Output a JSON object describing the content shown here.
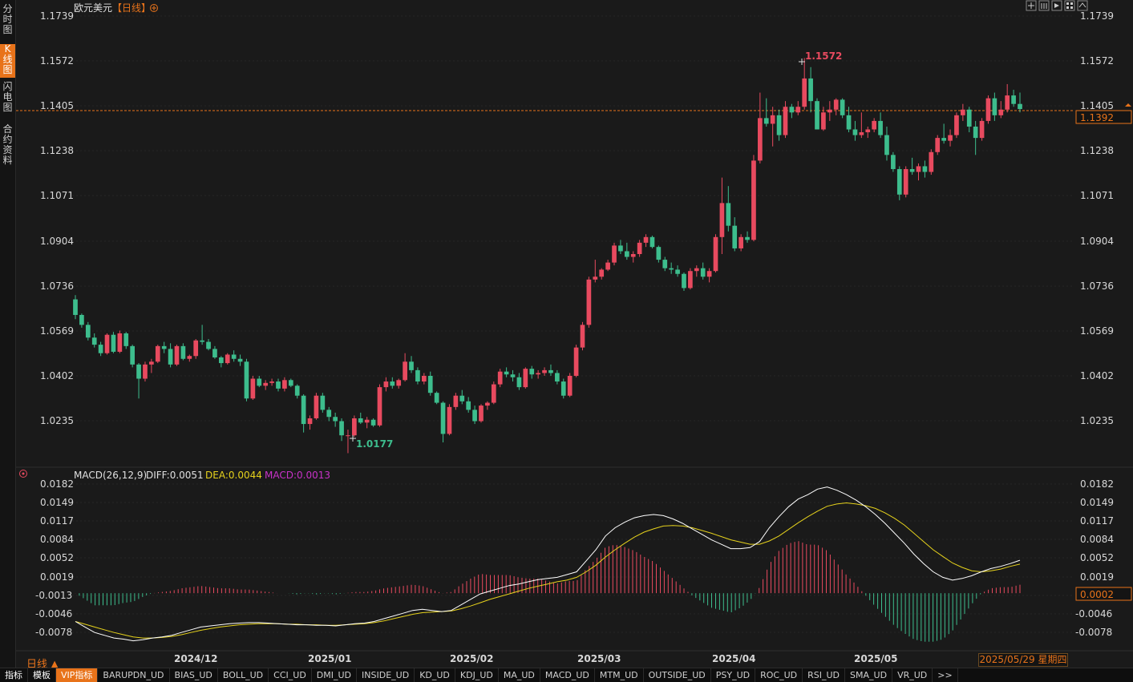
{
  "sidebar": {
    "tabs": [
      {
        "label": "分时图",
        "active": false
      },
      {
        "label": "K线图",
        "active": true
      },
      {
        "label": "闪电图",
        "active": false
      },
      {
        "label": "合约资料",
        "active": false
      }
    ]
  },
  "header": {
    "symbol": "欧元美元",
    "period_tag": "【日线】",
    "add_icon": "plus-circle-icon",
    "toolbar_icons": [
      "crosshair-icon",
      "table-icon",
      "play-icon",
      "grid-icon",
      "settings-icon"
    ]
  },
  "price_axis": {
    "labels": [
      "1.1739",
      "1.1572",
      "1.1405",
      "1.1238",
      "1.1071",
      "1.0904",
      "1.0736",
      "1.0569",
      "1.0402",
      "1.0235"
    ],
    "current_price": "1.1392"
  },
  "annotations": {
    "high": "1.1572",
    "low": "1.0177"
  },
  "macd": {
    "title": "MACD(26,12,9)",
    "diff": "DIFF:0.0051",
    "dea": "DEA:0.0044",
    "macd": "MACD:0.0013",
    "axis_labels": [
      "0.0182",
      "0.0149",
      "0.0117",
      "0.0084",
      "0.0052",
      "0.0019",
      "-0.0013",
      "-0.0046",
      "-0.0078"
    ],
    "current_value": "0.0002"
  },
  "time_axis": {
    "labels": [
      "2024/12",
      "2025/01",
      "2025/02",
      "2025/03",
      "2025/04",
      "2025/05"
    ]
  },
  "footer": {
    "period": "日线",
    "date": "2025/05/29 星期四",
    "tabs": [
      "指标",
      "模板",
      "VIP指标",
      "BARUPDN_UD",
      "BIAS_UD",
      "BOLL_UD",
      "CCI_UD",
      "DMI_UD",
      "INSIDE_UD",
      "KD_UD",
      "KDJ_UD",
      "MA_UD",
      "MACD_UD",
      "MTM_UD",
      "OUTSIDE_UD",
      "PSY_UD",
      "ROC_UD",
      "RSI_UD",
      "SMA_UD",
      "VR_UD",
      ">>"
    ]
  },
  "colors": {
    "up": "#e84a5f",
    "down": "#3dbd8d",
    "accent": "#e8731a",
    "diff_line": "#ffffff",
    "dea_line": "#e6d21c",
    "macd_label": "#c832c8"
  },
  "chart_data": {
    "type": "candlestick",
    "title": "欧元美元【日线】",
    "y_range": [
      1.015,
      1.176
    ],
    "x_ticks": [
      "2024/12",
      "2025/01",
      "2025/02",
      "2025/03",
      "2025/04",
      "2025/05"
    ],
    "ohlc": [
      [
        1.072,
        1.0735,
        1.065,
        1.0665
      ],
      [
        1.0665,
        1.067,
        1.062,
        1.063
      ],
      [
        1.063,
        1.064,
        1.0575,
        1.0585
      ],
      [
        1.0585,
        1.06,
        1.055,
        1.056
      ],
      [
        1.056,
        1.057,
        1.052,
        1.053
      ],
      [
        1.053,
        1.06,
        1.0525,
        1.0595
      ],
      [
        1.0595,
        1.0605,
        1.053,
        1.0535
      ],
      [
        1.0535,
        1.061,
        1.053,
        1.06
      ],
      [
        1.06,
        1.0605,
        1.0545,
        1.0555
      ],
      [
        1.0555,
        1.056,
        1.048,
        1.049
      ],
      [
        1.049,
        1.0495,
        1.037,
        1.044
      ],
      [
        1.044,
        1.05,
        1.043,
        1.049
      ],
      [
        1.049,
        1.051,
        1.046,
        1.05
      ],
      [
        1.05,
        1.056,
        1.0495,
        1.0555
      ],
      [
        1.0555,
        1.057,
        1.053,
        1.0545
      ],
      [
        1.0545,
        1.0565,
        1.048,
        1.049
      ],
      [
        1.049,
        1.056,
        1.0485,
        1.0555
      ],
      [
        1.0555,
        1.0565,
        1.0505,
        1.051
      ],
      [
        1.051,
        1.0525,
        1.05,
        1.052
      ],
      [
        1.052,
        1.058,
        1.051,
        1.0575
      ],
      [
        1.0575,
        1.063,
        1.056,
        1.057
      ],
      [
        1.057,
        1.058,
        1.054,
        1.0545
      ],
      [
        1.0545,
        1.0555,
        1.051,
        1.0515
      ],
      [
        1.0515,
        1.052,
        1.048,
        1.0495
      ],
      [
        1.0495,
        1.053,
        1.049,
        1.0525
      ],
      [
        1.0525,
        1.054,
        1.05,
        1.051
      ],
      [
        1.051,
        1.0525,
        1.0485,
        1.05
      ],
      [
        1.05,
        1.051,
        1.036,
        1.037
      ],
      [
        1.037,
        1.045,
        1.0365,
        1.044
      ],
      [
        1.044,
        1.045,
        1.041,
        1.0415
      ],
      [
        1.0415,
        1.0435,
        1.04,
        1.0425
      ],
      [
        1.0425,
        1.044,
        1.0415,
        1.043
      ],
      [
        1.043,
        1.044,
        1.0395,
        1.0405
      ],
      [
        1.0405,
        1.0445,
        1.0395,
        1.0435
      ],
      [
        1.0435,
        1.044,
        1.041,
        1.0415
      ],
      [
        1.0415,
        1.042,
        1.037,
        1.038
      ],
      [
        1.038,
        1.0385,
        1.025,
        1.028
      ],
      [
        1.028,
        1.031,
        1.026,
        1.03
      ],
      [
        1.03,
        1.039,
        1.0295,
        1.038
      ],
      [
        1.038,
        1.039,
        1.032,
        1.033
      ],
      [
        1.033,
        1.034,
        1.029,
        1.0305
      ],
      [
        1.0305,
        1.032,
        1.027,
        1.029
      ],
      [
        1.029,
        1.03,
        1.022,
        1.024
      ],
      [
        1.024,
        1.026,
        1.0177,
        1.024
      ],
      [
        1.024,
        1.031,
        1.0235,
        1.03
      ],
      [
        1.03,
        1.032,
        1.028,
        1.0285
      ],
      [
        1.0285,
        1.0305,
        1.0265,
        1.0295
      ],
      [
        1.0295,
        1.03,
        1.027,
        1.0275
      ],
      [
        1.0275,
        1.042,
        1.027,
        1.041
      ],
      [
        1.041,
        1.0445,
        1.0395,
        1.043
      ],
      [
        1.043,
        1.0445,
        1.0405,
        1.0415
      ],
      [
        1.0415,
        1.044,
        1.0405,
        1.0435
      ],
      [
        1.0435,
        1.053,
        1.043,
        1.05
      ],
      [
        1.05,
        1.052,
        1.046,
        1.047
      ],
      [
        1.047,
        1.048,
        1.042,
        1.043
      ],
      [
        1.043,
        1.046,
        1.042,
        1.045
      ],
      [
        1.045,
        1.0465,
        1.038,
        1.039
      ],
      [
        1.039,
        1.0395,
        1.035,
        1.0355
      ],
      [
        1.0355,
        1.036,
        1.0215,
        1.0245
      ],
      [
        1.0245,
        1.035,
        1.024,
        1.034
      ],
      [
        1.034,
        1.039,
        1.033,
        1.038
      ],
      [
        1.038,
        1.04,
        1.035,
        1.036
      ],
      [
        1.036,
        1.0375,
        1.032,
        1.033
      ],
      [
        1.033,
        1.0345,
        1.028,
        1.029
      ],
      [
        1.029,
        1.035,
        1.0285,
        1.0345
      ],
      [
        1.0345,
        1.036,
        1.033,
        1.0355
      ],
      [
        1.0355,
        1.043,
        1.035,
        1.042
      ],
      [
        1.042,
        1.0475,
        1.041,
        1.0465
      ],
      [
        1.0465,
        1.048,
        1.0445,
        1.0455
      ],
      [
        1.0455,
        1.047,
        1.043,
        1.0445
      ],
      [
        1.0445,
        1.046,
        1.04,
        1.041
      ],
      [
        1.041,
        1.048,
        1.0405,
        1.0475
      ],
      [
        1.0475,
        1.0485,
        1.044,
        1.0455
      ],
      [
        1.0455,
        1.047,
        1.044,
        1.046
      ],
      [
        1.046,
        1.048,
        1.045,
        1.047
      ],
      [
        1.047,
        1.049,
        1.045,
        1.046
      ],
      [
        1.046,
        1.047,
        1.042,
        1.043
      ],
      [
        1.043,
        1.044,
        1.037,
        1.038
      ],
      [
        1.038,
        1.046,
        1.0375,
        1.045
      ],
      [
        1.045,
        1.056,
        1.0445,
        1.055
      ],
      [
        1.055,
        1.064,
        1.054,
        1.063
      ],
      [
        1.063,
        1.08,
        1.062,
        1.079
      ],
      [
        1.079,
        1.086,
        1.078,
        1.08
      ],
      [
        1.08,
        1.083,
        1.079,
        1.0825
      ],
      [
        1.0825,
        1.086,
        1.082,
        1.085
      ],
      [
        1.085,
        1.092,
        1.084,
        1.091
      ],
      [
        1.091,
        1.093,
        1.088,
        1.089
      ],
      [
        1.089,
        1.092,
        1.086,
        1.087
      ],
      [
        1.087,
        1.089,
        1.085,
        1.088
      ],
      [
        1.088,
        1.093,
        1.087,
        1.092
      ],
      [
        1.092,
        1.095,
        1.0905,
        1.094
      ],
      [
        1.094,
        1.0945,
        1.09,
        1.0905
      ],
      [
        1.0905,
        1.091,
        1.085,
        1.086
      ],
      [
        1.086,
        1.087,
        1.082,
        1.083
      ],
      [
        1.083,
        1.085,
        1.081,
        1.0825
      ],
      [
        1.0825,
        1.084,
        1.08,
        1.081
      ],
      [
        1.081,
        1.0815,
        1.075,
        1.076
      ],
      [
        1.076,
        1.083,
        1.0755,
        1.082
      ],
      [
        1.082,
        1.084,
        1.08,
        1.083
      ],
      [
        1.083,
        1.085,
        1.079,
        1.08
      ],
      [
        1.08,
        1.083,
        1.078,
        1.082
      ],
      [
        1.082,
        1.095,
        1.0815,
        1.094
      ],
      [
        1.094,
        1.115,
        1.088,
        1.106
      ],
      [
        1.106,
        1.112,
        1.096,
        1.098
      ],
      [
        1.098,
        1.101,
        1.089,
        1.09
      ],
      [
        1.09,
        1.095,
        1.089,
        1.094
      ],
      [
        1.094,
        1.096,
        1.092,
        1.093
      ],
      [
        1.093,
        1.123,
        1.0925,
        1.121
      ],
      [
        1.121,
        1.145,
        1.12,
        1.136
      ],
      [
        1.136,
        1.143,
        1.133,
        1.134
      ],
      [
        1.134,
        1.14,
        1.126,
        1.137
      ],
      [
        1.137,
        1.139,
        1.128,
        1.13
      ],
      [
        1.13,
        1.142,
        1.129,
        1.14
      ],
      [
        1.14,
        1.141,
        1.136,
        1.138
      ],
      [
        1.138,
        1.142,
        1.137,
        1.14
      ],
      [
        1.14,
        1.1572,
        1.139,
        1.15
      ],
      [
        1.15,
        1.154,
        1.138,
        1.142
      ],
      [
        1.142,
        1.143,
        1.132,
        1.132
      ],
      [
        1.132,
        1.14,
        1.1315,
        1.138
      ],
      [
        1.138,
        1.142,
        1.135,
        1.139
      ],
      [
        1.139,
        1.143,
        1.137,
        1.1425
      ],
      [
        1.1425,
        1.143,
        1.136,
        1.137
      ],
      [
        1.137,
        1.14,
        1.131,
        1.132
      ],
      [
        1.132,
        1.135,
        1.128,
        1.13
      ],
      [
        1.13,
        1.138,
        1.129,
        1.131
      ],
      [
        1.131,
        1.133,
        1.129,
        1.132
      ],
      [
        1.132,
        1.136,
        1.131,
        1.135
      ],
      [
        1.135,
        1.138,
        1.129,
        1.13
      ],
      [
        1.13,
        1.133,
        1.121,
        1.123
      ],
      [
        1.123,
        1.124,
        1.117,
        1.118
      ],
      [
        1.118,
        1.119,
        1.107,
        1.109
      ],
      [
        1.109,
        1.119,
        1.108,
        1.118
      ],
      [
        1.118,
        1.122,
        1.116,
        1.117
      ],
      [
        1.117,
        1.12,
        1.114,
        1.119
      ],
      [
        1.119,
        1.121,
        1.115,
        1.117
      ],
      [
        1.117,
        1.125,
        1.116,
        1.124
      ],
      [
        1.124,
        1.13,
        1.123,
        1.129
      ],
      [
        1.129,
        1.134,
        1.127,
        1.128
      ],
      [
        1.128,
        1.132,
        1.126,
        1.13
      ],
      [
        1.13,
        1.138,
        1.129,
        1.137
      ],
      [
        1.137,
        1.141,
        1.135,
        1.139
      ],
      [
        1.139,
        1.14,
        1.131,
        1.133
      ],
      [
        1.133,
        1.135,
        1.123,
        1.129
      ],
      [
        1.129,
        1.136,
        1.128,
        1.135
      ],
      [
        1.135,
        1.144,
        1.134,
        1.143
      ],
      [
        1.143,
        1.145,
        1.135,
        1.137
      ],
      [
        1.137,
        1.142,
        1.136,
        1.139
      ],
      [
        1.139,
        1.148,
        1.138,
        1.144
      ],
      [
        1.144,
        1.146,
        1.14,
        1.141
      ],
      [
        1.141,
        1.145,
        1.138,
        1.1392
      ]
    ],
    "macd_panel": {
      "y_range": [
        -0.01,
        0.0195
      ],
      "diff": [
        -0.006,
        -0.007,
        -0.008,
        -0.0085,
        -0.009,
        -0.0092,
        -0.0095,
        -0.0093,
        -0.009,
        -0.0088,
        -0.0085,
        -0.008,
        -0.0075,
        -0.007,
        -0.0068,
        -0.0066,
        -0.0064,
        -0.0063,
        -0.0062,
        -0.0062,
        -0.0063,
        -0.0064,
        -0.0065,
        -0.0066,
        -0.0066,
        -0.0067,
        -0.0067,
        -0.0068,
        -0.0066,
        -0.0064,
        -0.0063,
        -0.006,
        -0.0055,
        -0.005,
        -0.0045,
        -0.004,
        -0.0038,
        -0.004,
        -0.0042,
        -0.004,
        -0.003,
        -0.002,
        -0.001,
        -0.0005,
        0.0,
        0.0005,
        0.0008,
        0.0012,
        0.0016,
        0.0018,
        0.002,
        0.0025,
        0.003,
        0.005,
        0.007,
        0.0095,
        0.011,
        0.012,
        0.0128,
        0.0132,
        0.0134,
        0.0132,
        0.0126,
        0.0118,
        0.0108,
        0.0098,
        0.0088,
        0.008,
        0.0072,
        0.0072,
        0.0074,
        0.0085,
        0.011,
        0.013,
        0.0148,
        0.0162,
        0.017,
        0.018,
        0.0184,
        0.0178,
        0.017,
        0.016,
        0.0148,
        0.0134,
        0.0118,
        0.01,
        0.0082,
        0.0062,
        0.0045,
        0.003,
        0.002,
        0.0015,
        0.0018,
        0.0023,
        0.003,
        0.0036,
        0.004,
        0.0045,
        0.0051
      ],
      "dea": [
        -0.006,
        -0.0065,
        -0.007,
        -0.0075,
        -0.008,
        -0.0084,
        -0.0088,
        -0.009,
        -0.009,
        -0.0089,
        -0.0087,
        -0.0084,
        -0.008,
        -0.0076,
        -0.0073,
        -0.007,
        -0.0068,
        -0.0066,
        -0.0065,
        -0.0064,
        -0.0064,
        -0.0064,
        -0.0065,
        -0.0065,
        -0.0066,
        -0.0066,
        -0.0067,
        -0.0067,
        -0.0066,
        -0.0065,
        -0.0064,
        -0.0062,
        -0.0059,
        -0.0055,
        -0.0051,
        -0.0047,
        -0.0044,
        -0.0043,
        -0.0042,
        -0.0041,
        -0.0037,
        -0.0032,
        -0.0026,
        -0.002,
        -0.0015,
        -0.001,
        -0.0005,
        0.0,
        0.0004,
        0.0008,
        0.0012,
        0.0015,
        0.002,
        0.003,
        0.0042,
        0.0057,
        0.007,
        0.0082,
        0.0093,
        0.0102,
        0.0108,
        0.0113,
        0.0114,
        0.0113,
        0.011,
        0.0105,
        0.01,
        0.0094,
        0.0088,
        0.0084,
        0.008,
        0.008,
        0.0086,
        0.0095,
        0.0107,
        0.0119,
        0.013,
        0.014,
        0.0149,
        0.0153,
        0.0155,
        0.0153,
        0.015,
        0.0145,
        0.0137,
        0.0127,
        0.0115,
        0.01,
        0.0085,
        0.007,
        0.0058,
        0.0046,
        0.0038,
        0.0032,
        0.003,
        0.0032,
        0.0035,
        0.004,
        0.0044
      ]
    }
  }
}
